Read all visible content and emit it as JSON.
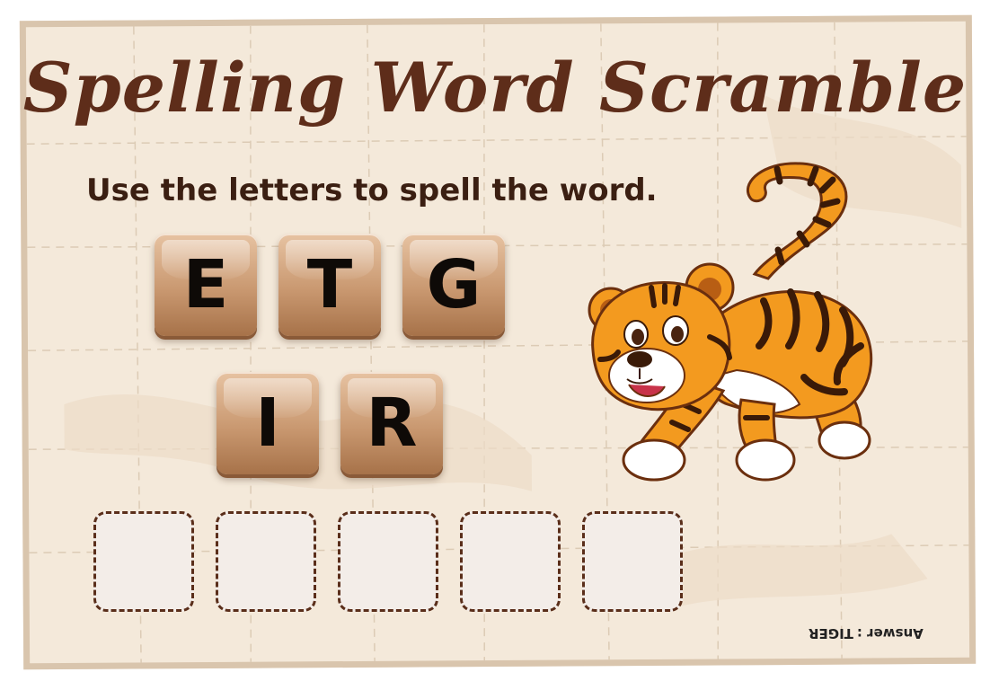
{
  "title": "Spelling Word Scramble",
  "instruction": "Use the letters to spell the word.",
  "letter_tiles": [
    "E",
    "T",
    "G",
    "I",
    "R"
  ],
  "answer_slots_count": 5,
  "answer": {
    "label": "Answer :",
    "word": "TIGER"
  },
  "picture": "tiger-illustration",
  "colors": {
    "paper": "#f4e9da",
    "title": "#5e2d1a",
    "tile": "#c99870",
    "slot_border": "#5a2e1a",
    "tiger_orange": "#f39a1f"
  }
}
